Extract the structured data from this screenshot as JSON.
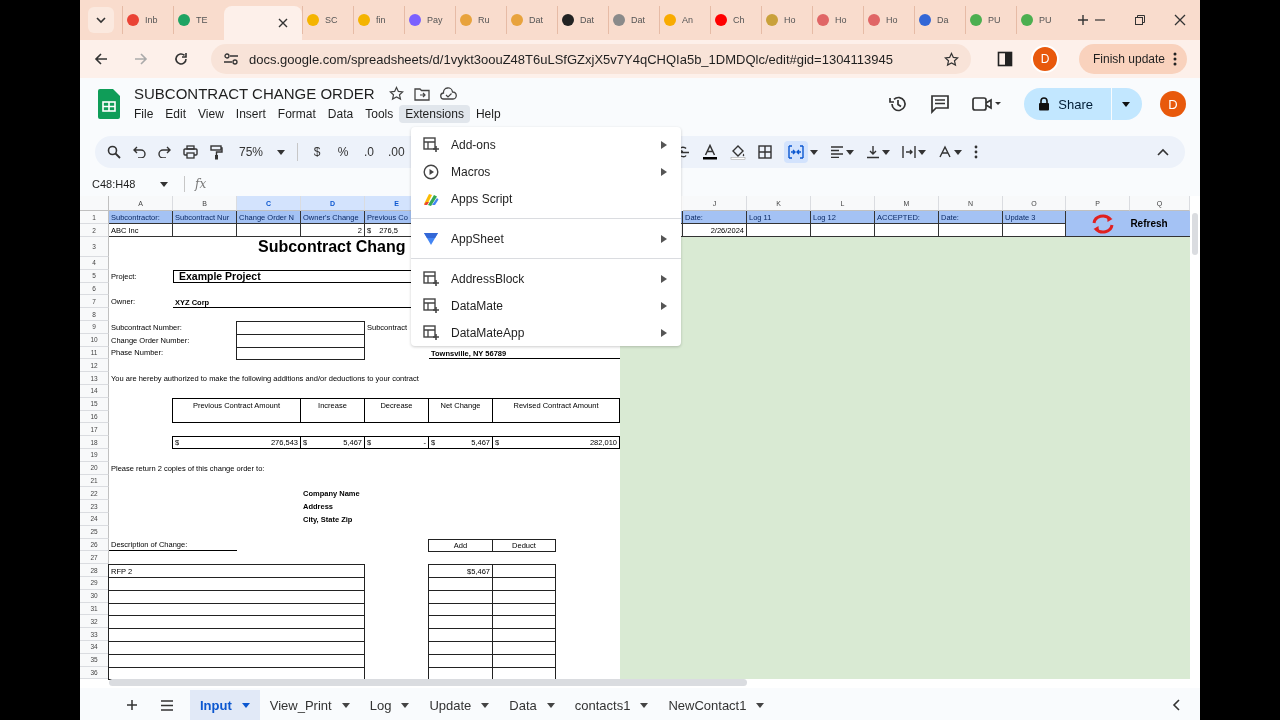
{
  "browser": {
    "tabs": [
      {
        "label": "Inb",
        "selected": false,
        "color": "#ea4335"
      },
      {
        "label": "TE",
        "selected": false,
        "color": "#1fa463"
      },
      {
        "selected": true
      },
      {
        "label": "SC",
        "selected": false,
        "color": "#f4b400"
      },
      {
        "label": "fin",
        "selected": false,
        "color": "#f4b400"
      },
      {
        "label": "Pay",
        "selected": false,
        "color": "#7b61ff"
      },
      {
        "label": "Ru",
        "selected": false,
        "color": "#e8a33d"
      },
      {
        "label": "Dat",
        "selected": false,
        "color": "#e8a33d"
      },
      {
        "label": "Dat",
        "selected": false,
        "color": "#222222"
      },
      {
        "label": "Dat",
        "selected": false,
        "color": "#8a8a8a"
      },
      {
        "label": "An",
        "selected": false,
        "color": "#f9ab00"
      },
      {
        "label": "Ch",
        "selected": false,
        "color": "#ff0000"
      },
      {
        "label": "Ho",
        "selected": false,
        "color": "#c9a13b"
      },
      {
        "label": "Ho",
        "selected": false,
        "color": "#e06666"
      },
      {
        "label": "Ho",
        "selected": false,
        "color": "#e06666"
      },
      {
        "label": "Da",
        "selected": false,
        "color": "#3367d6"
      },
      {
        "label": "PU",
        "selected": false,
        "color": "#4caf50"
      },
      {
        "label": "PU",
        "selected": false,
        "color": "#4caf50"
      }
    ],
    "url": "docs.google.com/spreadsheets/d/1vykt3oouZ48T6uLSfGZxjX5v7Y4qCHQIa5b_1DMDQlc/edit#gid=1304113945",
    "avatar": "D",
    "update_button": "Finish update"
  },
  "doc": {
    "title": "SUBCONTRACT CHANGE ORDER",
    "menus": [
      {
        "label": "File",
        "selected": false
      },
      {
        "label": "Edit",
        "selected": false
      },
      {
        "label": "View",
        "selected": false
      },
      {
        "label": "Insert",
        "selected": false
      },
      {
        "label": "Format",
        "selected": false
      },
      {
        "label": "Data",
        "selected": false
      },
      {
        "label": "Tools",
        "selected": false
      },
      {
        "label": "Extensions",
        "selected": true
      },
      {
        "label": "Help",
        "selected": false
      }
    ],
    "share": "Share",
    "avatar": "D"
  },
  "toolbar": {
    "zoom": "75%",
    "formats": [
      "$",
      "%",
      ".0",
      ".00"
    ]
  },
  "formula_bar": {
    "name_box": "C48:H48",
    "fx": "fx"
  },
  "sheet": {
    "columns": [
      {
        "label": "A",
        "selected": false
      },
      {
        "label": "B",
        "selected": false
      },
      {
        "label": "C",
        "selected": true
      },
      {
        "label": "D",
        "selected": true
      },
      {
        "label": "E",
        "selected": true
      },
      {
        "label": "J",
        "selected": false
      },
      {
        "label": "K",
        "selected": false
      },
      {
        "label": "L",
        "selected": false
      },
      {
        "label": "M",
        "selected": false
      },
      {
        "label": "N",
        "selected": false
      },
      {
        "label": "O",
        "selected": false
      },
      {
        "label": "P",
        "selected": false
      },
      {
        "label": "Q",
        "selected": false
      }
    ],
    "rows": [
      {
        "n": "1",
        "cells": [
          {
            "kind": "head",
            "text": "Subcontractor:"
          },
          {
            "kind": "head",
            "text": "Subcontract Nur"
          },
          {
            "kind": "head",
            "text": "Change Order N"
          },
          {
            "kind": "head",
            "text": "Owner's Change"
          },
          {
            "kind": "head",
            "text": "Previous Co"
          },
          {
            "kind": "head"
          },
          {
            "kind": "head",
            "text": "Date:"
          },
          {
            "kind": "head",
            "text": "Log 11"
          },
          {
            "kind": "head",
            "text": "Log 12"
          },
          {
            "kind": "head",
            "text": "ACCEPTED:"
          },
          {
            "kind": "head",
            "text": "Date:"
          },
          {
            "kind": "head",
            "text": "Update 3"
          },
          {
            "kind": "refresh",
            "text": "Refresh"
          }
        ]
      },
      {
        "n": "2",
        "cells": [
          {
            "kind": "data",
            "text": "ABC Inc"
          },
          {
            "kind": "data"
          },
          {
            "kind": "data"
          },
          {
            "kind": "data_num",
            "text": "2"
          },
          {
            "kind": "money_left",
            "currency": "$",
            "text": "276,5"
          },
          {
            "kind": "data"
          },
          {
            "kind": "data_num",
            "text": "2/26/2024"
          },
          {
            "kind": "data"
          },
          {
            "kind": "data"
          },
          {
            "kind": "data"
          },
          {
            "kind": "data"
          },
          {
            "kind": "data"
          }
        ]
      },
      {
        "n": "3",
        "cells": [
          {
            "kind": "title",
            "text": "Subcontract Chang"
          }
        ]
      },
      {
        "n": "4"
      },
      {
        "n": "5",
        "cells": [
          {
            "kind": "label",
            "text": "Project:"
          },
          {
            "kind": "bold_box",
            "text": "Example Project"
          }
        ]
      },
      {
        "n": "6"
      },
      {
        "n": "7",
        "cells": [
          {
            "kind": "label",
            "text": "Owner:"
          },
          {
            "kind": "bold_line",
            "text": "XYZ Corp"
          }
        ]
      },
      {
        "n": "8"
      },
      {
        "n": "9",
        "cells": [
          {
            "kind": "label",
            "text": "Subcontract Number:"
          },
          {
            "kind": "box"
          },
          {
            "kind": "label",
            "text": "Subcontract"
          }
        ]
      },
      {
        "n": "10",
        "cells": [
          {
            "kind": "label",
            "text": "Change Order Number:"
          },
          {
            "kind": "box"
          }
        ]
      },
      {
        "n": "11",
        "cells": [
          {
            "kind": "label",
            "text": "Phase Number:"
          },
          {
            "kind": "box"
          },
          {
            "kind": "bold_line",
            "text": "Townsville, NY 56789"
          }
        ]
      },
      {
        "n": "12"
      },
      {
        "n": "13",
        "cells": [
          {
            "kind": "label",
            "text": "You are hereby authorized to make the following additions and/or deductions to your contract"
          }
        ]
      },
      {
        "n": "14"
      },
      {
        "n": "15",
        "cells": [
          {
            "kind": "box_head",
            "text": "Previous Contract Amount"
          },
          {
            "kind": "box_head",
            "text": "Increase"
          },
          {
            "kind": "box_head",
            "text": "Decrease"
          },
          {
            "kind": "box_head",
            "text": "Net Change"
          },
          {
            "kind": "box_head",
            "text": "Revised Contract Amount"
          }
        ]
      },
      {
        "n": "16"
      },
      {
        "n": "17"
      },
      {
        "n": "18",
        "cells": [
          {
            "kind": "money",
            "currency": "$",
            "text": "276,543"
          },
          {
            "kind": "money",
            "currency": "$",
            "text": "5,467"
          },
          {
            "kind": "money",
            "currency": "$",
            "text": "-"
          },
          {
            "kind": "money",
            "currency": "$",
            "text": "5,467"
          },
          {
            "kind": "money",
            "currency": "$",
            "text": "282,010"
          }
        ]
      },
      {
        "n": "19"
      },
      {
        "n": "20",
        "cells": [
          {
            "kind": "label",
            "text": "Please return 2 copies of this change order to:"
          }
        ]
      },
      {
        "n": "21"
      },
      {
        "n": "22",
        "cells": [
          {
            "kind": "bold",
            "text": "Company Name"
          }
        ]
      },
      {
        "n": "23",
        "cells": [
          {
            "kind": "bold",
            "text": "Address"
          }
        ]
      },
      {
        "n": "24",
        "cells": [
          {
            "kind": "bold",
            "text": "City, State  Zip"
          }
        ]
      },
      {
        "n": "25"
      },
      {
        "n": "26",
        "cells": [
          {
            "kind": "line_label",
            "text": "Description of Change:"
          },
          {
            "kind": "box_c",
            "text": "Add"
          },
          {
            "kind": "box_c",
            "text": "Deduct"
          }
        ]
      },
      {
        "n": "27"
      },
      {
        "n": "28",
        "cells": [
          {
            "kind": "box",
            "text": "RFP 2"
          },
          {
            "kind": "box_right",
            "text": "$5,467"
          },
          {
            "kind": "box"
          }
        ]
      },
      {
        "n": "29",
        "cells": [
          {
            "kind": "box"
          },
          {
            "kind": "box"
          },
          {
            "kind": "box"
          }
        ]
      },
      {
        "n": "30",
        "cells": [
          {
            "kind": "box"
          },
          {
            "kind": "box"
          },
          {
            "kind": "box"
          }
        ]
      },
      {
        "n": "31",
        "cells": [
          {
            "kind": "box"
          },
          {
            "kind": "box"
          },
          {
            "kind": "box"
          }
        ]
      },
      {
        "n": "32",
        "cells": [
          {
            "kind": "box"
          },
          {
            "kind": "box"
          },
          {
            "kind": "box"
          }
        ]
      },
      {
        "n": "33",
        "cells": [
          {
            "kind": "box"
          },
          {
            "kind": "box"
          },
          {
            "kind": "box"
          }
        ]
      },
      {
        "n": "34",
        "cells": [
          {
            "kind": "box"
          },
          {
            "kind": "box"
          },
          {
            "kind": "box"
          }
        ]
      },
      {
        "n": "35",
        "cells": [
          {
            "kind": "box"
          },
          {
            "kind": "box"
          },
          {
            "kind": "box"
          }
        ]
      },
      {
        "n": "36",
        "cells": [
          {
            "kind": "box"
          },
          {
            "kind": "box"
          },
          {
            "kind": "box"
          }
        ]
      }
    ]
  },
  "menu": {
    "groups": [
      [
        {
          "label": "Add-ons",
          "submenu": true
        },
        {
          "label": "Macros",
          "submenu": true
        },
        {
          "label": "Apps Script",
          "submenu": false
        }
      ],
      [
        {
          "label": "AppSheet",
          "submenu": true
        }
      ],
      [
        {
          "label": "AddressBlock",
          "submenu": true
        },
        {
          "label": "DataMate",
          "submenu": true
        },
        {
          "label": "DataMateApp",
          "submenu": true
        }
      ]
    ]
  },
  "sheet_tabs": [
    {
      "label": "Input",
      "selected": true
    },
    {
      "label": "View_Print",
      "selected": false
    },
    {
      "label": "Log",
      "selected": false
    },
    {
      "label": "Update",
      "selected": false
    },
    {
      "label": "Data",
      "selected": false
    },
    {
      "label": "contacts1",
      "selected": false
    },
    {
      "label": "NewContact1",
      "selected": false
    }
  ]
}
